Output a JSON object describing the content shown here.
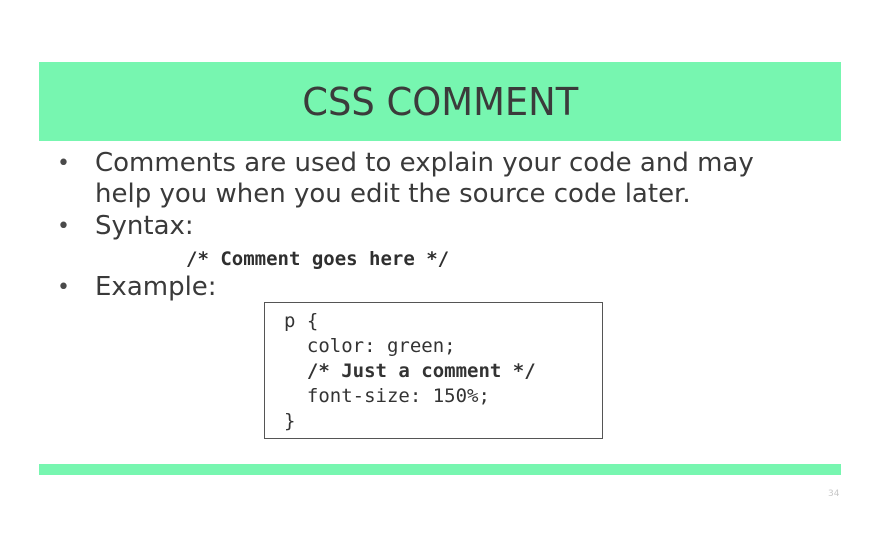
{
  "slide": {
    "title": "CSS COMMENT",
    "bullets": [
      {
        "marker": "•",
        "text": "Comments are used to explain your code and may help you when you edit the source code later."
      },
      {
        "marker": "•",
        "text": "Syntax:"
      },
      {
        "marker": "•",
        "text": "Example:"
      }
    ],
    "syntax_code": "/* Comment goes here */",
    "example_code": [
      "p {",
      "  color: green;",
      "  /* Just a comment */",
      "  font-size: 150%;",
      "}"
    ],
    "page_number": "34"
  },
  "colors": {
    "accent": "#77f6b0",
    "text": "#3a3a3a",
    "page_number": "#c8c8c8"
  }
}
